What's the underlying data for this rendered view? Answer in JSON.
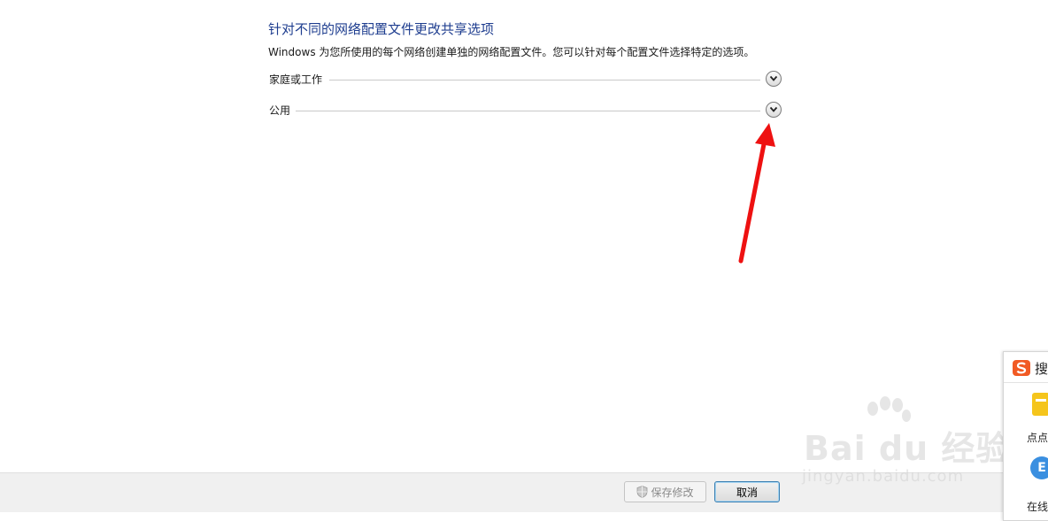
{
  "page": {
    "title": "针对不同的网络配置文件更改共享选项",
    "description": "Windows 为您所使用的每个网络创建单独的网络配置文件。您可以针对每个配置文件选择特定的选项。"
  },
  "profiles": [
    {
      "label": "家庭或工作",
      "icon": "chevron-down-icon"
    },
    {
      "label": "公用",
      "icon": "chevron-down-icon"
    }
  ],
  "footer": {
    "save_label": "保存修改",
    "save_icon": "uac-shield-icon",
    "cancel_label": "取消"
  },
  "ime_panel": {
    "title": "搜",
    "item1_label": "点点",
    "item2_icon_letter": "E",
    "item2_label": "在线"
  },
  "watermark": {
    "main": "Bai du 经验",
    "sub": "jingyan.baidu.com"
  },
  "colors": {
    "title": "#1e3d8f",
    "annotation_arrow": "#ee1111"
  }
}
